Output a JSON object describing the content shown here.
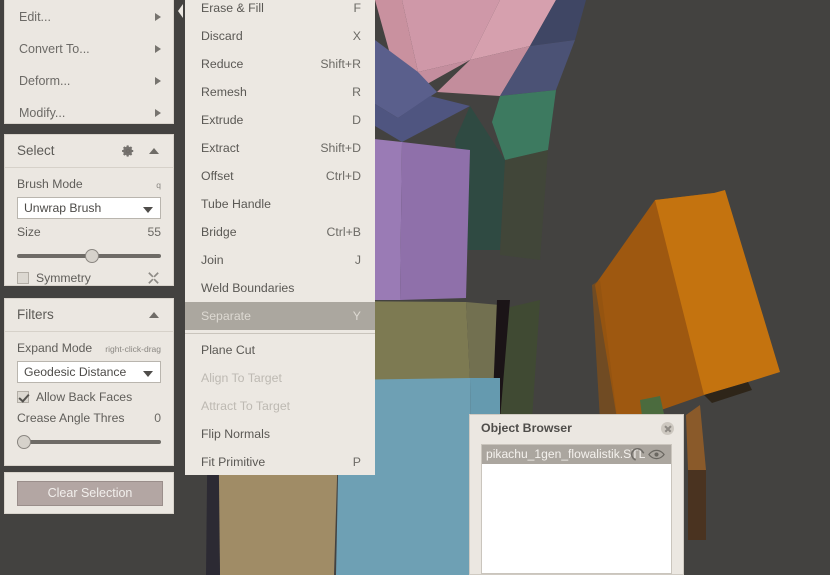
{
  "app": {
    "viewport": {
      "background": "#434240",
      "colors": {
        "pink": "#cf98a8",
        "rose": "#9a6d73",
        "blue_slate": "#5a5f8c",
        "purple": "#9a7bb5",
        "olive": "#7d7a52",
        "teal_dark": "#2f4a42",
        "green": "#3d7a60",
        "steel_blue": "#6ea0b4",
        "tan": "#a08c66",
        "orange_light": "#cf7a1b",
        "orange_dark": "#9e5810",
        "forest": "#404a33",
        "near_black": "#1b1417"
      }
    }
  },
  "left_panel": {
    "actions": [
      {
        "label": "Edit...",
        "icon": "chevron-right-icon"
      },
      {
        "label": "Convert To...",
        "icon": "chevron-right-icon"
      },
      {
        "label": "Deform...",
        "icon": "chevron-right-icon"
      },
      {
        "label": "Modify...",
        "icon": "chevron-right-icon"
      }
    ],
    "select_section": {
      "title": "Select",
      "gear_icon": "gear-icon",
      "collapse_icon": "chevron-up-icon",
      "brush_mode_label": "Brush Mode",
      "brush_mode_hint": "q",
      "brush_mode_value": "Unwrap Brush",
      "size_label": "Size",
      "size_value": "55",
      "size_percent": 52,
      "symmetry_label": "Symmetry",
      "symmetry_checked": false,
      "symmetry_tool_icon": "wrench-icon"
    },
    "filters_section": {
      "title": "Filters",
      "collapse_icon": "chevron-up-icon",
      "expand_mode_label": "Expand Mode",
      "expand_mode_hint": "right-click-drag",
      "expand_mode_value": "Geodesic Distance",
      "allow_back_faces_label": "Allow Back Faces",
      "allow_back_faces_checked": true,
      "crease_label": "Crease Angle Thres",
      "crease_value": "0",
      "crease_percent": 0
    },
    "clear_selection_label": "Clear Selection"
  },
  "context_menu": {
    "items": [
      {
        "label": "Erase & Fill",
        "shortcut": "F",
        "state": "normal"
      },
      {
        "label": "Discard",
        "shortcut": "X",
        "state": "normal"
      },
      {
        "label": "Reduce",
        "shortcut": "Shift+R",
        "state": "normal"
      },
      {
        "label": "Remesh",
        "shortcut": "R",
        "state": "normal"
      },
      {
        "label": "Extrude",
        "shortcut": "D",
        "state": "normal"
      },
      {
        "label": "Extract",
        "shortcut": "Shift+D",
        "state": "normal"
      },
      {
        "label": "Offset",
        "shortcut": "Ctrl+D",
        "state": "normal"
      },
      {
        "label": "Tube Handle",
        "shortcut": "",
        "state": "normal"
      },
      {
        "label": "Bridge",
        "shortcut": "Ctrl+B",
        "state": "normal"
      },
      {
        "label": "Join",
        "shortcut": "J",
        "state": "normal"
      },
      {
        "label": "Weld Boundaries",
        "shortcut": "",
        "state": "normal"
      },
      {
        "label": "Separate",
        "shortcut": "Y",
        "state": "selected"
      },
      {
        "label": "Plane Cut",
        "shortcut": "",
        "state": "normal",
        "separator_above": true
      },
      {
        "label": "Align To Target",
        "shortcut": "",
        "state": "disabled"
      },
      {
        "label": "Attract To Target",
        "shortcut": "",
        "state": "disabled"
      },
      {
        "label": "Flip Normals",
        "shortcut": "",
        "state": "normal"
      },
      {
        "label": "Fit Primitive",
        "shortcut": "P",
        "state": "normal"
      }
    ]
  },
  "object_browser": {
    "title": "Object Browser",
    "close_icon": "close-circle-icon",
    "items": [
      {
        "name": "pikachu_1gen_flowalistik.STL",
        "lock_icon": "magnet-icon",
        "visibility_icon": "eye-icon",
        "selected": true
      }
    ]
  }
}
